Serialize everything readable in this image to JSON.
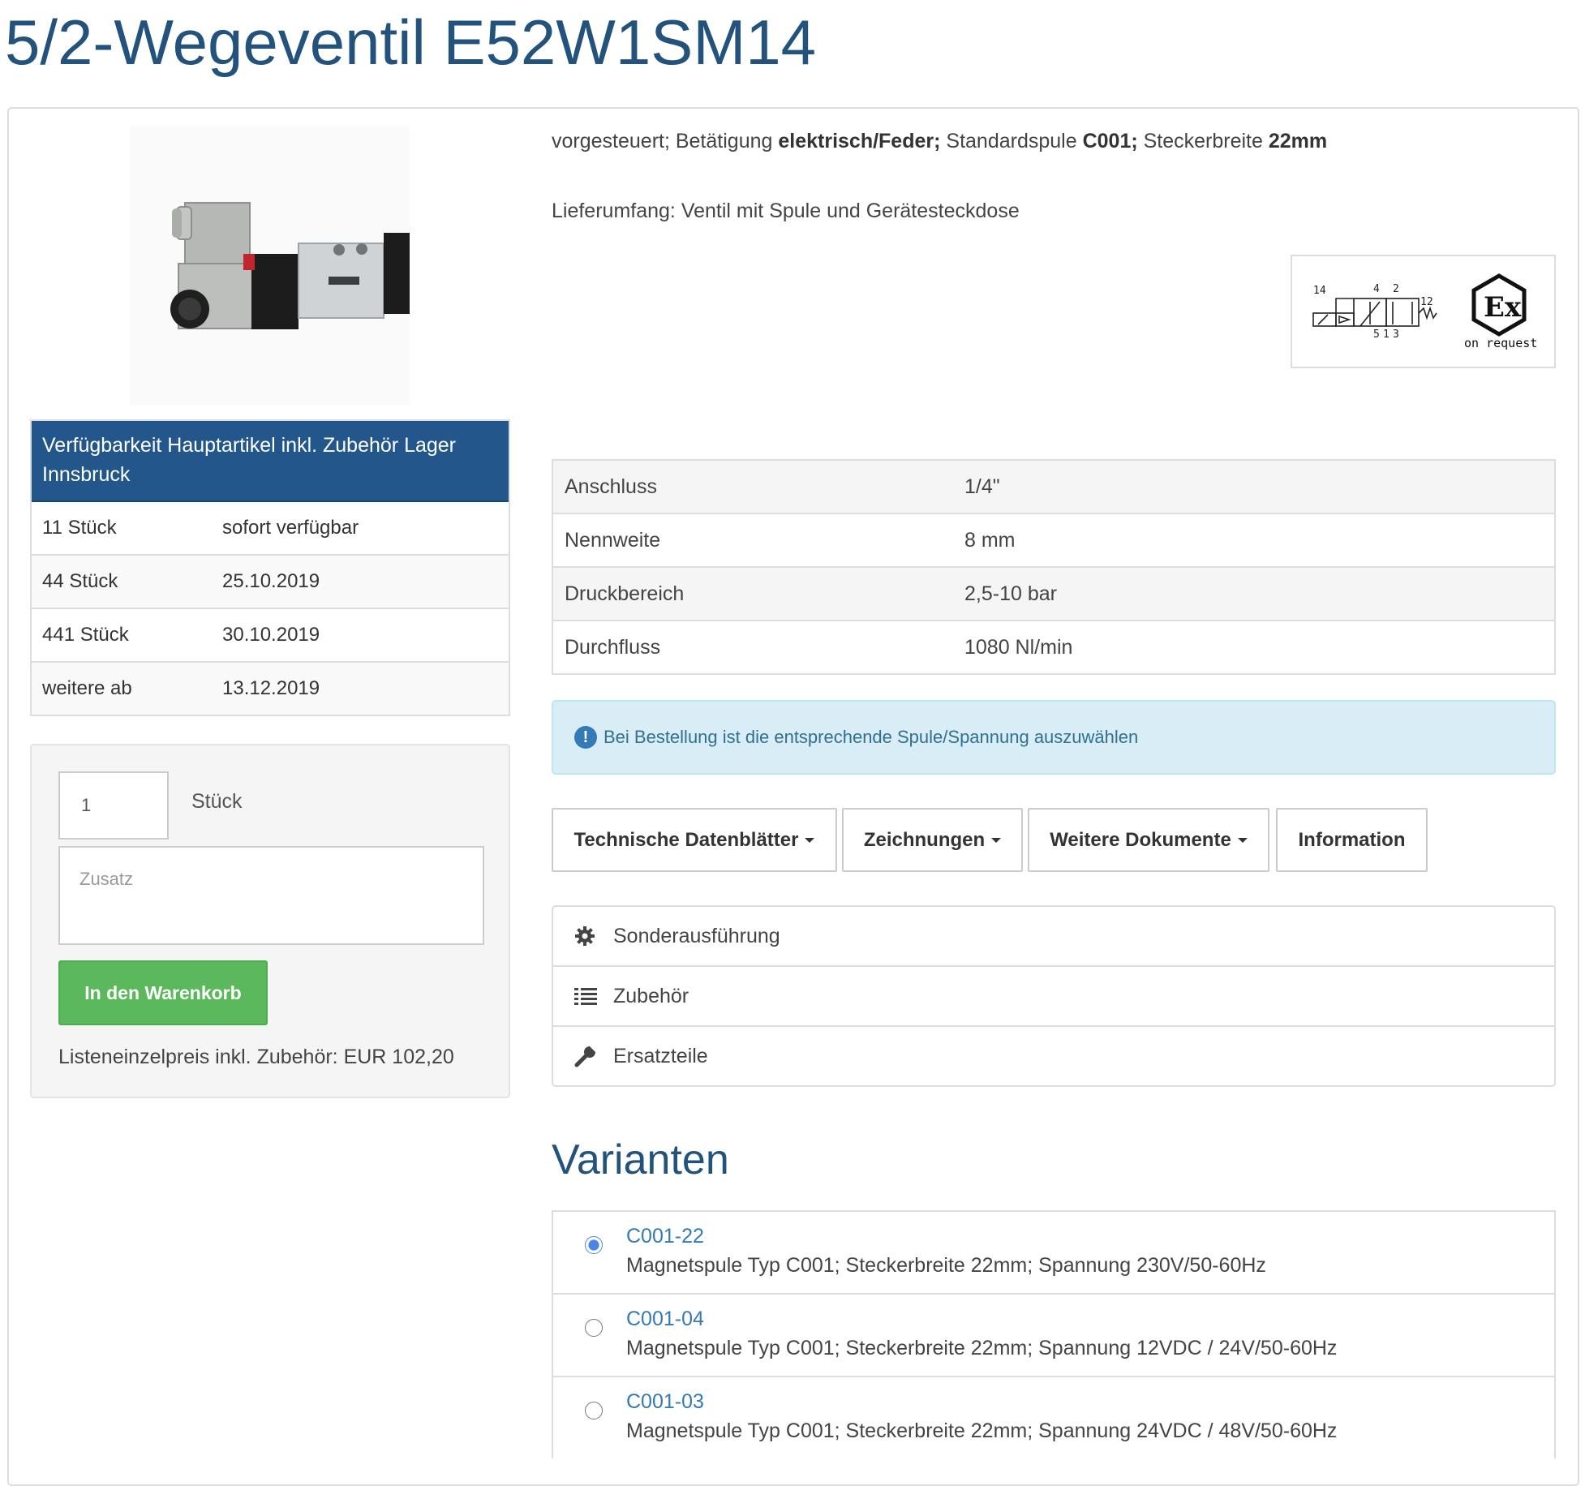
{
  "page": {
    "title": "5/2-Wegeventil E52W1SM14"
  },
  "product": {
    "description": {
      "prefix": "vorgesteuert; Betätigung ",
      "actuation": "elektrisch/Feder;",
      "coil_label": " Standardspule ",
      "coil": "C001;",
      "plug_label": " Steckerbreite ",
      "plug_width": "22mm"
    },
    "scope_of_delivery": "Lieferumfang: Ventil mit Spule und Gerätesteckdose",
    "symbols": {
      "port_labels": [
        "14",
        "4",
        "2",
        "12",
        "5",
        "1",
        "3"
      ],
      "ex_text": "on request"
    }
  },
  "availability": {
    "header": "Verfügbarkeit Hauptartikel inkl. Zubehör Lager Innsbruck",
    "rows": [
      {
        "qty": "11 Stück",
        "date": "sofort verfügbar"
      },
      {
        "qty": "44 Stück",
        "date": "25.10.2019"
      },
      {
        "qty": "441 Stück",
        "date": "30.10.2019"
      },
      {
        "qty": "weitere ab",
        "date": "13.12.2019"
      }
    ]
  },
  "order": {
    "quantity": "1",
    "unit": "Stück",
    "note_placeholder": "Zusatz",
    "add_to_cart_label": "In den Warenkorb",
    "price": "Listeneinzelpreis inkl. Zubehör: EUR 102,20"
  },
  "specs": [
    {
      "key": "Anschluss",
      "value": "1/4\""
    },
    {
      "key": "Nennweite",
      "value": "8 mm"
    },
    {
      "key": "Druckbereich",
      "value": "2,5-10 bar"
    },
    {
      "key": "Durchfluss",
      "value": "1080 Nl/min"
    }
  ],
  "alert": {
    "icon": "info-circle-icon",
    "text": "Bei Bestellung ist die entsprechende Spule/Spannung auszuwählen"
  },
  "buttons": {
    "datasheets": "Technische Datenblätter",
    "drawings": "Zeichnungen",
    "documents": "Weitere Dokumente",
    "information": "Information"
  },
  "links": [
    {
      "icon": "gear-icon",
      "label": "Sonderausführung"
    },
    {
      "icon": "list-icon",
      "label": "Zubehör"
    },
    {
      "icon": "wrench-icon",
      "label": "Ersatzteile"
    }
  ],
  "variants": {
    "title": "Varianten",
    "items": [
      {
        "code": "C001-22",
        "desc": "Magnetspule Typ C001; Steckerbreite 22mm; Spannung 230V/50-60Hz",
        "selected": true
      },
      {
        "code": "C001-04",
        "desc": "Magnetspule Typ C001; Steckerbreite 22mm; Spannung 12VDC / 24V/50-60Hz",
        "selected": false
      },
      {
        "code": "C001-03",
        "desc": "Magnetspule Typ C001; Steckerbreite 22mm; Spannung 24VDC / 48V/50-60Hz",
        "selected": false
      }
    ]
  },
  "colors": {
    "brand_blue": "#23527c",
    "header_blue": "#23568a",
    "link_blue": "#337ab7",
    "cart_green": "#5cb85c",
    "alert_bg": "#d9edf7"
  }
}
